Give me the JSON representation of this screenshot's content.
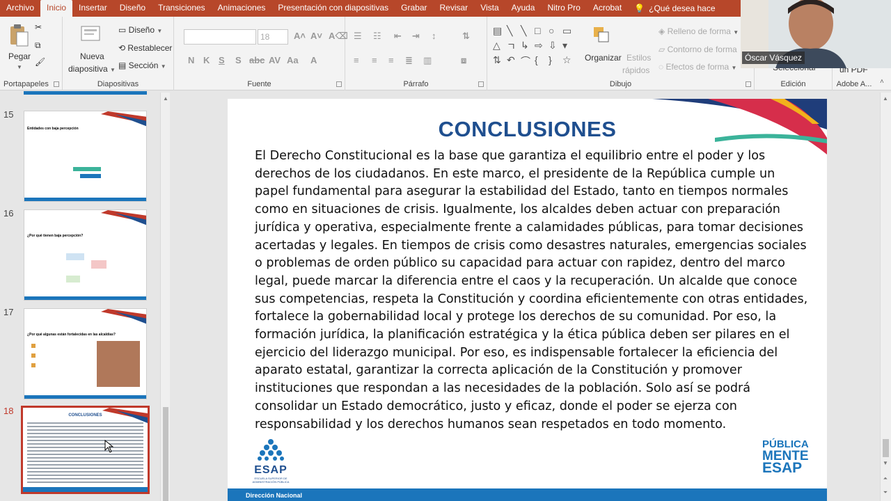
{
  "tabs": [
    "Archivo",
    "Inicio",
    "Insertar",
    "Diseño",
    "Transiciones",
    "Animaciones",
    "Presentación con diapositivas",
    "Grabar",
    "Revisar",
    "Vista",
    "Ayuda",
    "Nitro Pro",
    "Acrobat"
  ],
  "help_text": "¿Qué desea hace",
  "ribbon": {
    "clipboard": {
      "label": "Portapapeles",
      "paste": "Pegar"
    },
    "slides": {
      "label": "Diapositivas",
      "new_slide_1": "Nueva",
      "new_slide_2": "diapositiva",
      "layout": "Diseño",
      "reset": "Restablecer",
      "section": "Sección"
    },
    "font": {
      "label": "Fuente",
      "size": "18",
      "bold": "N",
      "italic": "K",
      "underline": "S",
      "strike": "S",
      "shadow": "abc"
    },
    "paragraph": {
      "label": "Párrafo"
    },
    "drawing": {
      "label": "Dibujo",
      "arrange": "Organizar",
      "styles_1": "Estilos",
      "styles_2": "rápidos",
      "fill": "Relleno de forma",
      "outline": "Contorno de forma",
      "effects": "Efectos de forma"
    },
    "editing": {
      "label": "Edición",
      "select": "Seleccionar"
    },
    "adobe": {
      "label": "Adobe A...",
      "pdf": "un PDF"
    }
  },
  "webcam": {
    "name": "Óscar Vásquez"
  },
  "thumbnails": [
    {
      "num": "15",
      "title": "Entidades con baja percepción"
    },
    {
      "num": "16",
      "title": "¿Por qué tienen baja percepción?"
    },
    {
      "num": "17",
      "title": "¿Por qué algunas están fortalecidas en las alcaldías?"
    },
    {
      "num": "18",
      "title": "CONCLUSIONES"
    }
  ],
  "slide": {
    "title": "CONCLUSIONES",
    "body": "El Derecho Constitucional es la base que garantiza el equilibrio entre el poder y los derechos de los ciudadanos. En este marco, el presidente de la República cumple un papel fundamental para asegurar la estabilidad del Estado, tanto en tiempos normales como en situaciones de crisis. Igualmente, los alcaldes deben actuar con preparación jurídica y operativa, especialmente frente a calamidades públicas, para tomar decisiones acertadas y legales. En tiempos de crisis  como desastres naturales, emergencias sociales o problemas de orden público su capacidad para actuar con rapidez, dentro del marco legal, puede marcar la diferencia entre el caos y la recuperación. Un alcalde que conoce sus competencias, respeta la Constitución y coordina eficientemente con otras entidades, fortalece la gobernabilidad local y protege los derechos de su comunidad. Por eso, la formación jurídica, la planificación estratégica y la ética pública deben ser pilares en el ejercicio del liderazgo municipal. Por eso, es indispensable fortalecer la eficiencia del aparato estatal, garantizar la correcta aplicación de la Constitución y promover instituciones que respondan a las necesidades de la población. Solo así se podrá consolidar un Estado democrático, justo y eficaz, donde el poder se ejerza con responsabilidad y los derechos humanos sean respetados en todo momento.",
    "footer": "Dirección Nacional",
    "esap_logo": "ESAP",
    "esap_subtitle": "ESCUELA SUPERIOR DE ADMINISTRACIÓN PÚBLICA",
    "pme": [
      "PÚBLICA",
      "MENTE",
      "ESAP"
    ]
  }
}
